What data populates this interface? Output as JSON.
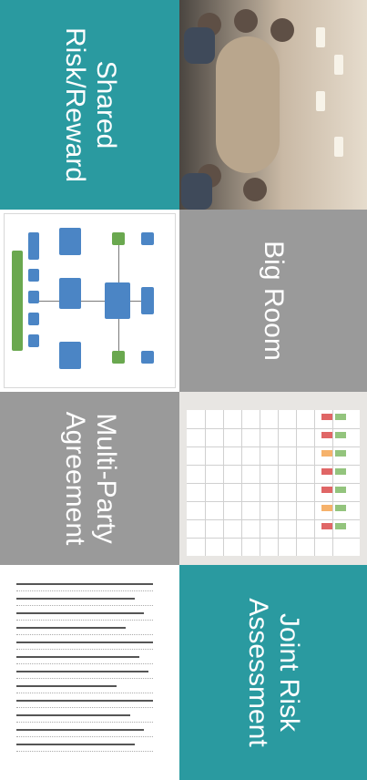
{
  "tiles": {
    "shared_risk_reward": {
      "label_line1": "Shared",
      "label_line2": "Risk/Reward"
    },
    "big_room": {
      "label": "Big Room"
    },
    "multi_party_agreement": {
      "label_line1": "Multi-Party",
      "label_line2": "Agreement"
    },
    "joint_risk_assessment": {
      "label_line1": "Joint Risk",
      "label_line2": "Assessment"
    }
  },
  "colors": {
    "teal": "#2a9aa0",
    "gray": "#9a9a9a",
    "diagram_blue": "#4b85c5",
    "diagram_green": "#6aa84f"
  }
}
